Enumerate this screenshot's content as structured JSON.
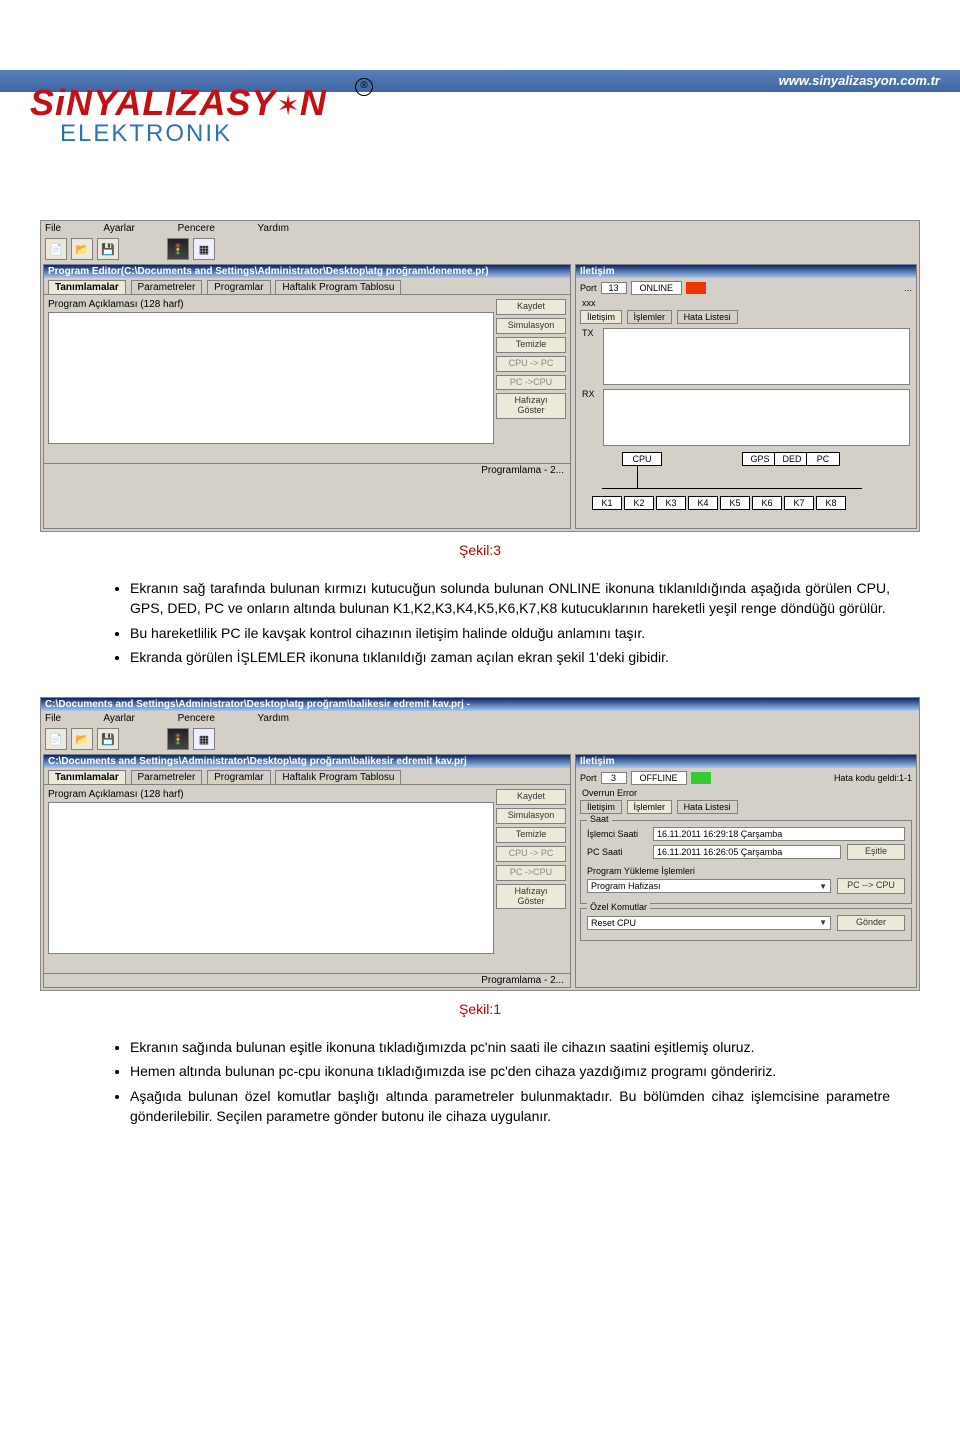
{
  "brand": {
    "name_main": "SiNYALIZASY",
    "name_star": "✶",
    "name_tail": "N",
    "sub": "ELEKTRONIK",
    "tm": "®",
    "url": "www.sinyalizasyon.com.tr"
  },
  "screenshot1": {
    "menu": {
      "file": "File",
      "ayarlar": "Ayarlar",
      "pencere": "Pencere",
      "yardim": "Yardım"
    },
    "title": "Program Editor(C:\\Documents and Settings\\Administrator\\Desktop\\atg proğram\\denemee.pr)",
    "tabs": {
      "t1": "Tanımlamalar",
      "t2": "Parametreler",
      "t3": "Programlar",
      "t4": "Haftalık Program Tablosu"
    },
    "desc_label": "Program Açıklaması (128 harf)",
    "buttons": {
      "kaydet": "Kaydet",
      "simulasyon": "Simulasyon",
      "temizle": "Temizle",
      "cpu_pc": "CPU -> PC",
      "pc_cpu": "PC ->CPU",
      "hafiza_goster": "Hafızayı\nGöster"
    },
    "right_title": "Iletişim",
    "port_label": "Port",
    "port_value": "13",
    "online_label": "ONLINE",
    "xxx": "xxx",
    "rtabs": {
      "t1": "İletişim",
      "t2": "İşlemler",
      "t3": "Hata Listesi"
    },
    "tx": "TX",
    "rx": "RX",
    "diagram": {
      "cpu": "CPU",
      "gps": "GPS",
      "ded": "DED",
      "pc": "PC",
      "k1": "K1",
      "k2": "K2",
      "k3": "K3",
      "k4": "K4",
      "k5": "K5",
      "k6": "K6",
      "k7": "K7",
      "k8": "K8"
    },
    "status": "Programlama - 2..."
  },
  "caption1": "Şekil:3",
  "bullets1": {
    "b1": "Ekranın sağ tarafında bulunan kırmızı kutucuğun solunda bulunan ONLINE ikonuna tıklanıldığında aşağıda görülen CPU, GPS, DED, PC ve onların altında bulunan K1,K2,K3,K4,K5,K6,K7,K8 kutucuklarının hareketli yeşil renge döndüğü görülür.",
    "b2": "Bu hareketlilik PC ile kavşak kontrol cihazının iletişim halinde olduğu anlamını taşır.",
    "b3": "Ekranda görülen İŞLEMLER ikonuna tıklanıldığı zaman açılan ekran şekil 1'deki gibidir."
  },
  "screenshot2": {
    "titlebar": "C:\\Documents and Settings\\Administrator\\Desktop\\atg proğram\\balikesir edremit kav.prj  -",
    "menu": {
      "file": "File",
      "ayarlar": "Ayarlar",
      "pencere": "Pencere",
      "yardim": "Yardım"
    },
    "pathbar": "C:\\Documents and Settings\\Administrator\\Desktop\\atg proğram\\balikesir edremit kav.prj",
    "tabs": {
      "t1": "Tanımlamalar",
      "t2": "Parametreler",
      "t3": "Programlar",
      "t4": "Haftalık Program Tablosu"
    },
    "desc_label": "Program Açıklaması (128 harf)",
    "buttons": {
      "kaydet": "Kaydet",
      "simulasyon": "Simulasyon",
      "temizle": "Temizle",
      "cpu_pc": "CPU -> PC",
      "pc_cpu": "PC ->CPU",
      "hafiza_goster": "Hafızayı\nGöster"
    },
    "right_title": "Iletişim",
    "port_label": "Port",
    "port_value": "3",
    "offline_label": "OFFLINE",
    "hata_label": "Hata kodu geldi:1-1",
    "overrun": "Overrun Error",
    "rtabs": {
      "t1": "İletişim",
      "t2": "İşlemler",
      "t3": "Hata Listesi"
    },
    "saat_group": "Saat",
    "islemci_saati": "İşlemci Saati",
    "islemci_val": "16.11.2011 16:29:18 Çarşamba",
    "pc_saati": "PC Saati",
    "pc_val": "16.11.2011 16:26:05 Çarşamba",
    "esitle": "Eşitle",
    "program_yukleme": "Program Yükleme İşlemleri",
    "program_hafizasi": "Program Hafizası",
    "pc_cpu_btn": "PC --> CPU",
    "ozel_komutlar": "Özel Komutlar",
    "reset_cpu": "Reset CPU",
    "gonder": "Gönder",
    "status": "Programlama - 2..."
  },
  "caption2": "Şekil:1",
  "bullets2": {
    "b1": "Ekranın sağında bulunan eşitle ikonuna tıkladığımızda pc'nin saati ile cihazın saatini eşitlemiş oluruz.",
    "b2": "Hemen altında bulunan pc-cpu ikonuna tıkladığımızda ise pc'den cihaza yazdığımız programı göndeririz.",
    "b3": "Aşağıda bulunan özel komutlar başlığı altında parametreler bulunmaktadır. Bu bölümden cihaz işlemcisine parametre gönderilebilir. Seçilen parametre gönder butonu ile cihaza uygulanır."
  }
}
